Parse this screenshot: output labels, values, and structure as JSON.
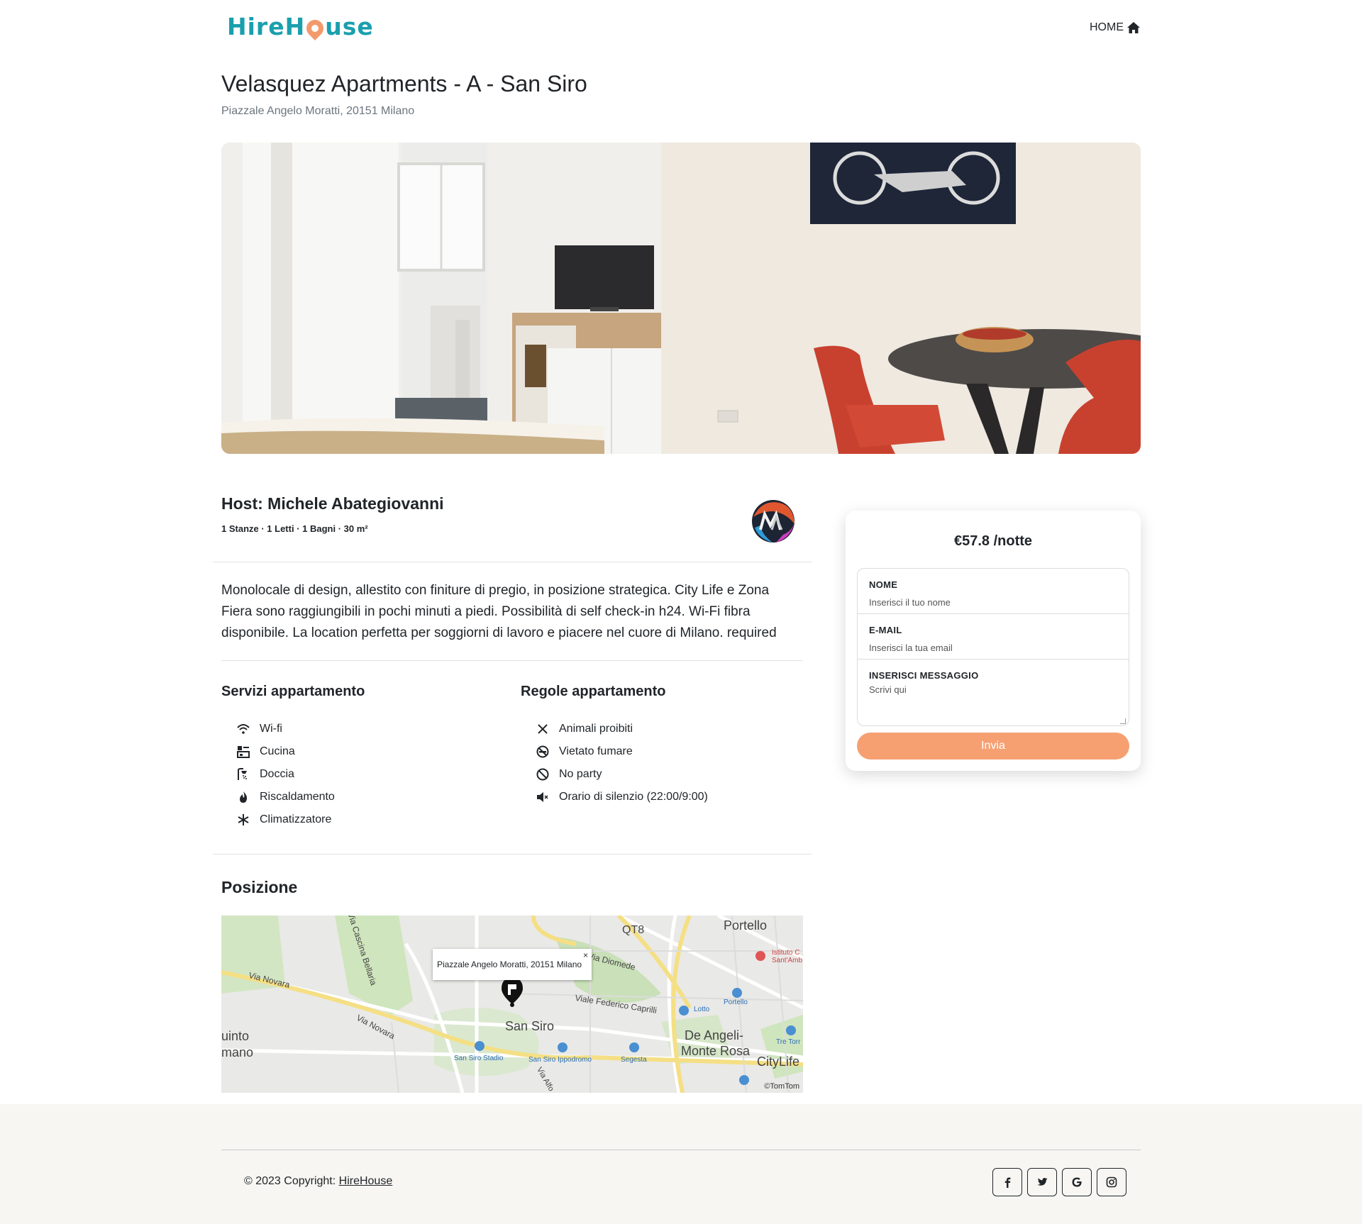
{
  "header": {
    "logo_text_left": "HireH",
    "logo_text_right": "use",
    "home_label": "HOME"
  },
  "listing": {
    "title": "Velasquez Apartments - A - San Siro",
    "address": "Piazzale Angelo Moratti, 20151 Milano",
    "host": "Host: Michele Abategiovanni",
    "stats": "1 Stanze · 1 Letti · 1 Bagni · 30 m²",
    "description": "Monolocale di design, allestito con finiture di pregio, in posizione strategica. City Life e Zona Fiera sono raggiungibili in pochi minuti a piedi. Possibilità di self check-in h24. Wi-Fi fibra disponibile. La location perfetta per soggiorni di lavoro e piacere nel cuore di Milano. required"
  },
  "services": {
    "heading": "Servizi appartamento",
    "items": [
      {
        "label": "Wi-fi",
        "icon": "wifi-icon"
      },
      {
        "label": "Cucina",
        "icon": "kitchen-icon"
      },
      {
        "label": "Doccia",
        "icon": "shower-icon"
      },
      {
        "label": "Riscaldamento",
        "icon": "fire-icon"
      },
      {
        "label": "Climatizzatore",
        "icon": "snowflake-icon"
      }
    ]
  },
  "rules": {
    "heading": "Regole appartamento",
    "items": [
      {
        "label": "Animali proibiti",
        "icon": "x-icon"
      },
      {
        "label": "Vietato fumare",
        "icon": "no-smoking-icon"
      },
      {
        "label": "No party",
        "icon": "ban-icon"
      },
      {
        "label": "Orario di silenzio (22:00/9:00)",
        "icon": "mute-icon"
      }
    ]
  },
  "position": {
    "heading": "Posizione",
    "popup": "Piazzale Angelo Moratti, 20151 Milano",
    "popup_close": "×",
    "attribution": "©TomTom",
    "labels": {
      "qt8": "QT8",
      "portello": "Portello",
      "san_siro": "San Siro",
      "de_angeli": "De Angeli-",
      "monte_rosa": "Monte Rosa",
      "citylife": "CityLife",
      "via_novara": "Via Novara",
      "via_novara2": "Via Novara",
      "via_cascina": "Via Cascina Bellaria",
      "via_diomede": "Via Diomede",
      "viale_caprilli": "Viale Federico Caprilli",
      "lotto": "Lotto",
      "portello_stop": "Portello",
      "san_siro_stadio": "San Siro Stadio",
      "san_siro_ippodromo": "San Siro Ippodromo",
      "segesta": "Segesta",
      "tre_torri": "Tre Torr",
      "istituto": "Istituto C",
      "santamb": "Sant'Amb",
      "quinto": "uinto",
      "romano": "mano",
      "via_alfo": "Via Alfo"
    }
  },
  "booking": {
    "price": "€57.8 /notte",
    "name_label": "NOME",
    "name_placeholder": "Inserisci il tuo nome",
    "email_label": "E-MAIL",
    "email_placeholder": "Inserisci la tua email",
    "message_label": "INSERISCI MESSAGGIO",
    "message_placeholder": "Scrivi qui",
    "submit": "Invia"
  },
  "footer": {
    "copyright": "© 2023 Copyright: ",
    "brand_link": "HireHouse",
    "socials": [
      "facebook-icon",
      "twitter-icon",
      "google-icon",
      "instagram-icon"
    ]
  },
  "colors": {
    "brand": "#1a9fae",
    "accent": "#f6a072",
    "footer_bg": "#f7f6f3"
  }
}
